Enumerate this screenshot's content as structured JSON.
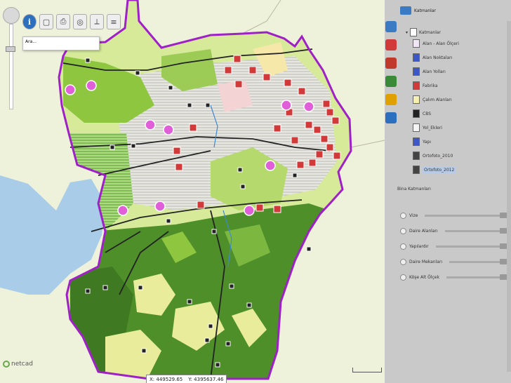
{
  "map": {
    "search_text": "Ara...",
    "coordinates": {
      "x": "X: 449529.65",
      "y": "Y: 4395637.46"
    },
    "logo_text": "netcad",
    "colors": {
      "background": "#eef2da",
      "boundary": "#a020c8",
      "forest_dark": "#4e8f2a",
      "forest_light": "#8ec63f",
      "agriculture": "#e9ec9a",
      "urban_hatch": "#c8c8c8",
      "lake": "#a9cce8",
      "road": "#222222",
      "marker_red": "#d23a3a",
      "marker_pink": "#e05fd8"
    },
    "toolbar": [
      {
        "name": "info-button",
        "icon": "info-icon",
        "glyph": "i"
      },
      {
        "name": "doc-button",
        "icon": "doc-icon",
        "glyph": "▢"
      },
      {
        "name": "print-button",
        "icon": "print-icon",
        "glyph": "⎙"
      },
      {
        "name": "globe-button",
        "icon": "globe-icon",
        "glyph": "◎"
      },
      {
        "name": "measure-button",
        "icon": "measure-icon",
        "glyph": "⟂"
      },
      {
        "name": "layers-button",
        "icon": "layers-icon",
        "glyph": "≡"
      }
    ]
  },
  "panel": {
    "title": "Katmanlar",
    "root_label": "Katmanlar",
    "layers": [
      {
        "label": "Alan - Alan Ölçeri",
        "color": "#f1e6f6"
      },
      {
        "label": "Alan Noktaları",
        "color": "#3c57c8"
      },
      {
        "label": "Alan Yolları",
        "color": "#3c57c8"
      },
      {
        "label": "Fabrika",
        "color": "#d23a3a"
      },
      {
        "label": "Çalım Alanları",
        "color": "#f5efb0"
      },
      {
        "label": "CBS",
        "color": "#222222"
      },
      {
        "label": "Yol_Ekleri",
        "color": "#f4f4f4"
      },
      {
        "label": "Yapı",
        "color": "#3c57c8"
      },
      {
        "label": "Ortofoto_2010",
        "color": "#444444"
      },
      {
        "label": "Ortofoto_2012",
        "color": "#444444",
        "selected": true
      }
    ],
    "favorites_title": "Bina Katmanları",
    "favorites": [
      {
        "label": "Vize"
      },
      {
        "label": "Daire Alanları"
      },
      {
        "label": "Yapılardır"
      },
      {
        "label": "Daire Mekanları"
      },
      {
        "label": "Köşe Alt Ölçek"
      }
    ],
    "side_tabs": [
      "layers-tab-icon",
      "legend-tab-icon",
      "search-tab-icon",
      "chart-tab-icon",
      "tools-tab-icon",
      "help-tab-icon"
    ]
  }
}
